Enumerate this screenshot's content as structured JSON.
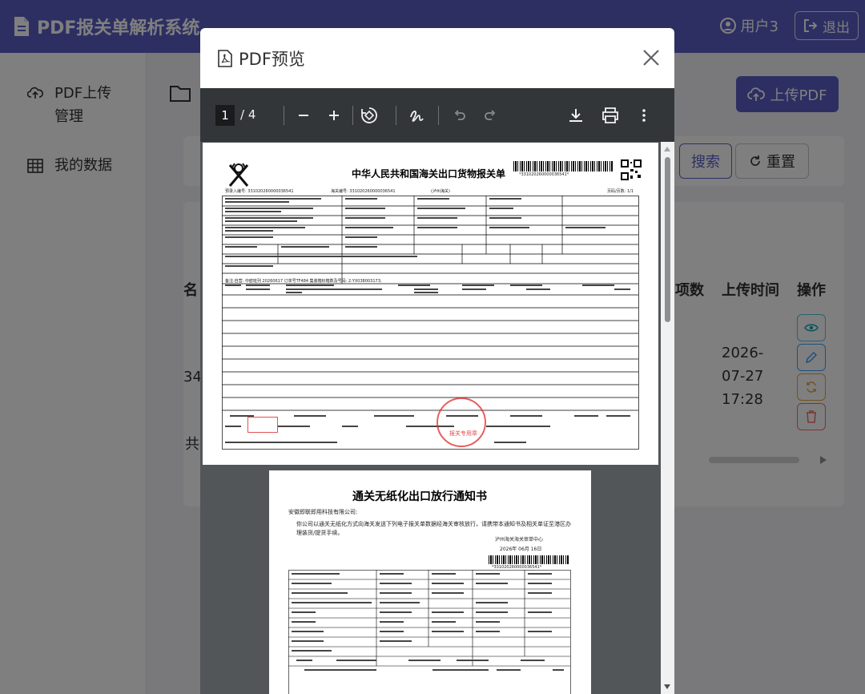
{
  "app": {
    "title": "PDF报关单解析系统",
    "user": "用户3",
    "logout": "退出",
    "colors": {
      "primary": "#5b5fc7",
      "edit": "#409eff",
      "refresh": "#e6a23c",
      "delete": "#f56c6c",
      "view": "#17a2b8"
    }
  },
  "sidebar": {
    "items": [
      {
        "label": "PDF上传管理",
        "icon": "upload-cloud-icon"
      },
      {
        "label": "我的数据",
        "icon": "table-icon"
      }
    ]
  },
  "main": {
    "upload_button": "上传PDF",
    "search_button": "搜索",
    "reset_button": "重置",
    "columns": {
      "name_fragment": "名",
      "items": "项数",
      "upload_time": "上传时间",
      "actions": "操作"
    },
    "row": {
      "fragment": "34.",
      "upload_time": "2026-07-27 17:28"
    },
    "total_fragment": "共"
  },
  "modal": {
    "title": "PDF预览",
    "viewer": {
      "current_page": "1",
      "total_pages": "/ 4"
    },
    "page1": {
      "title": "中华人民共和国海关出口货物报关单",
      "barcode_text": "*331020260000036541*",
      "pre_entry": "预录入编号: 331020260000036541",
      "entry_no": "海关编号: 331020260000036541",
      "customs": "(泸州海关)",
      "page_info": "页码/页数: 1/1",
      "remarks": "备注:自营: 中欧班列 20260617 订单号TF484 集装箱标箱数及号码: 2:YX038003173;",
      "stamp_text": "报关专用章"
    },
    "page2": {
      "title": "通关无纸化出口放行通知书",
      "addressee": "安徽即联即用科技有限公司:",
      "body": "你公司以通关无纸化方式向海关发送下列电子报关单数据经海关审核放行，请携带本通知书及相关单证至港区办理装货/提货手续。",
      "center": "泸州海关海关审单中心",
      "date": "2026年  06月  16日",
      "barcode_text": "*331020260000036541*"
    }
  }
}
